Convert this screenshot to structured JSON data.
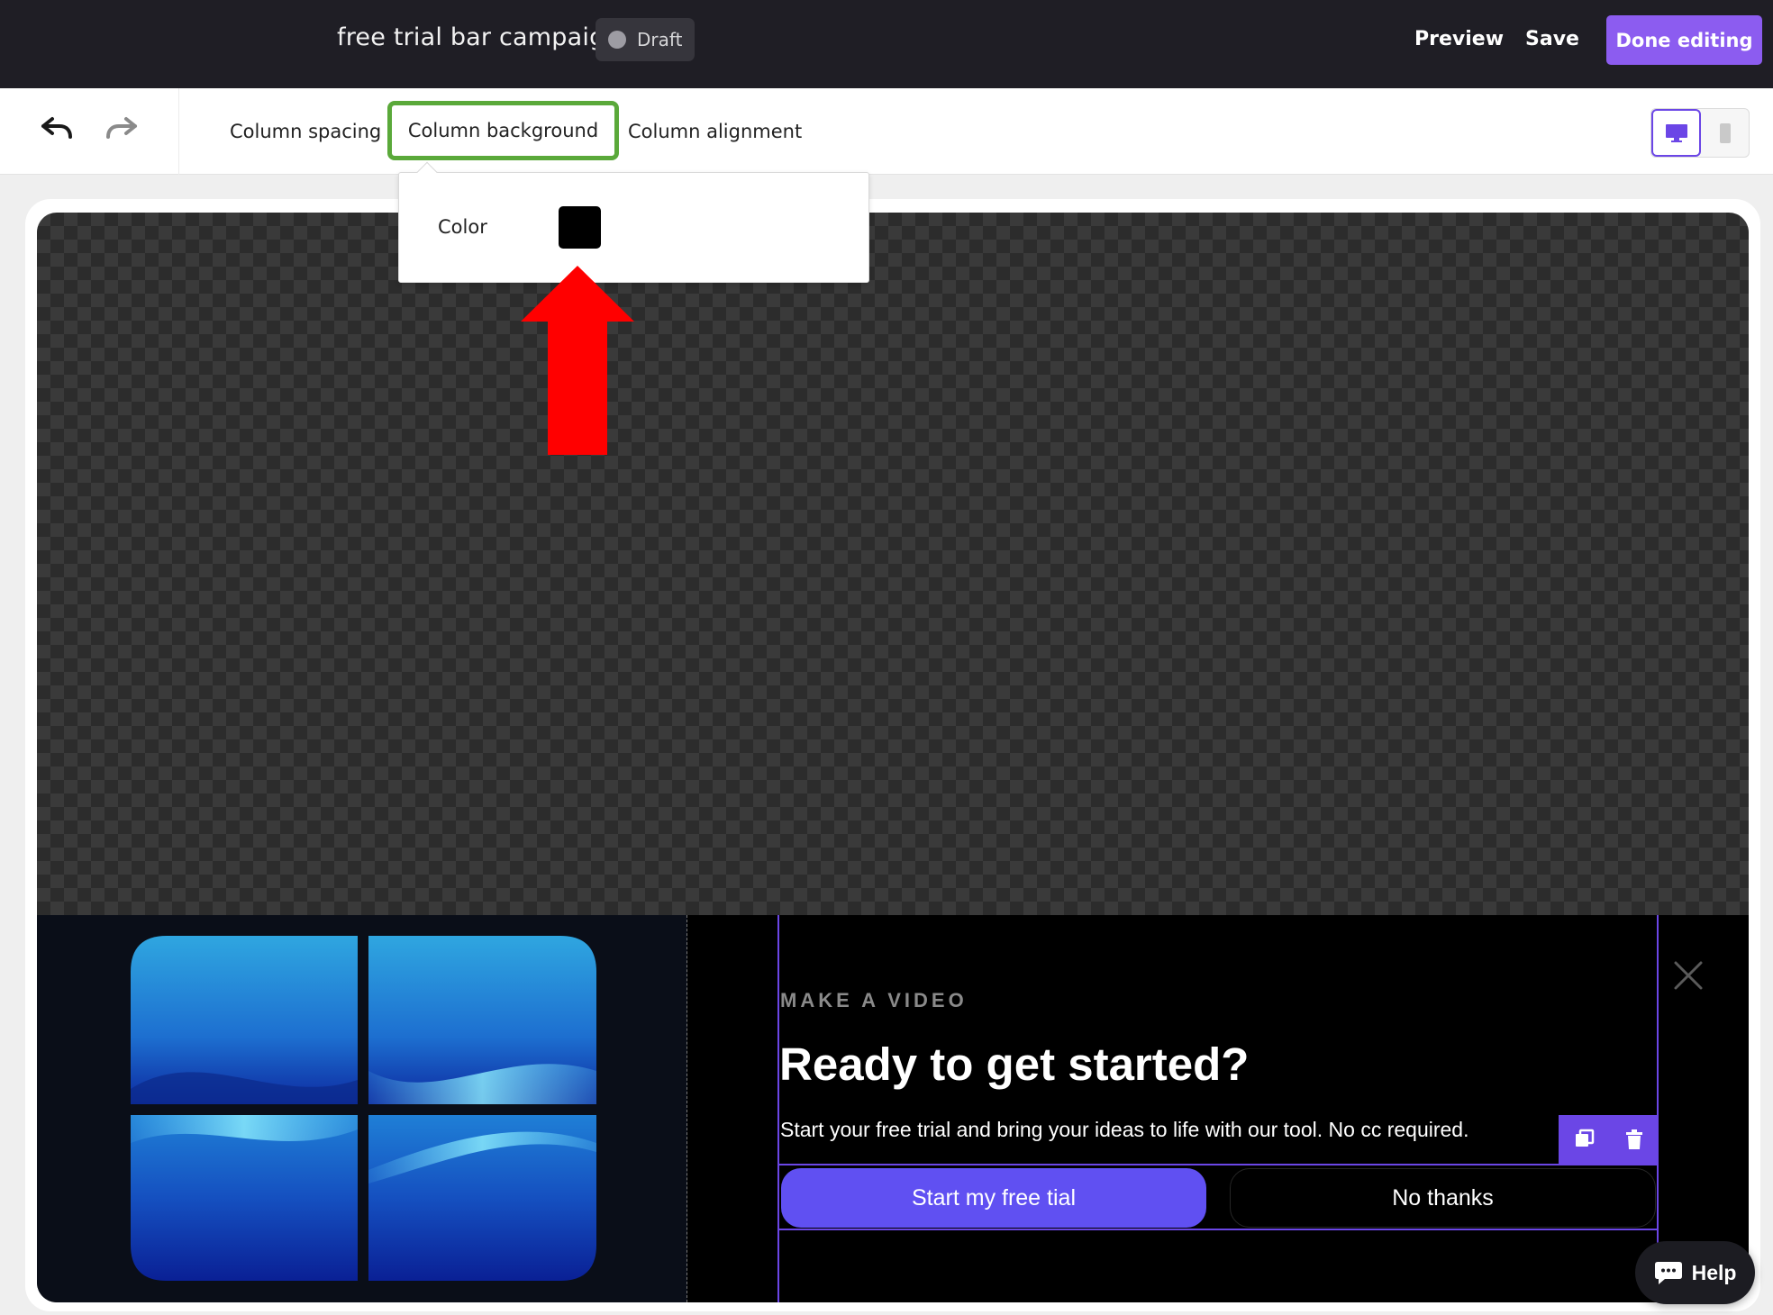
{
  "header": {
    "campaign_title": "free trial bar campaign",
    "status": "Draft",
    "preview_label": "Preview",
    "save_label": "Save",
    "done_label": "Done editing"
  },
  "toolbar": {
    "tabs": [
      {
        "label": "Column spacing"
      },
      {
        "label": "Column background",
        "active": true
      },
      {
        "label": "Column alignment"
      }
    ],
    "device_view": "desktop"
  },
  "popover": {
    "color_label": "Color",
    "color_value": "#000000"
  },
  "banner": {
    "eyebrow": "MAKE A VIDEO",
    "headline": "Ready to get started?",
    "subtext": "Start your free trial and bring your ideas to life with our tool. No cc required.",
    "primary_button": "Start my free tial",
    "secondary_button": "No thanks"
  },
  "help": {
    "label": "Help"
  },
  "colors": {
    "accent": "#8c5cf0",
    "selection": "#6b46e6",
    "primary_button": "#6050f2",
    "active_tab_border": "#5aa93a",
    "annotation_arrow": "#ff0000"
  },
  "icons": [
    "undo-icon",
    "redo-icon",
    "desktop-icon",
    "mobile-icon",
    "duplicate-icon",
    "trash-icon",
    "close-icon",
    "chat-icon",
    "status-dot-icon"
  ]
}
